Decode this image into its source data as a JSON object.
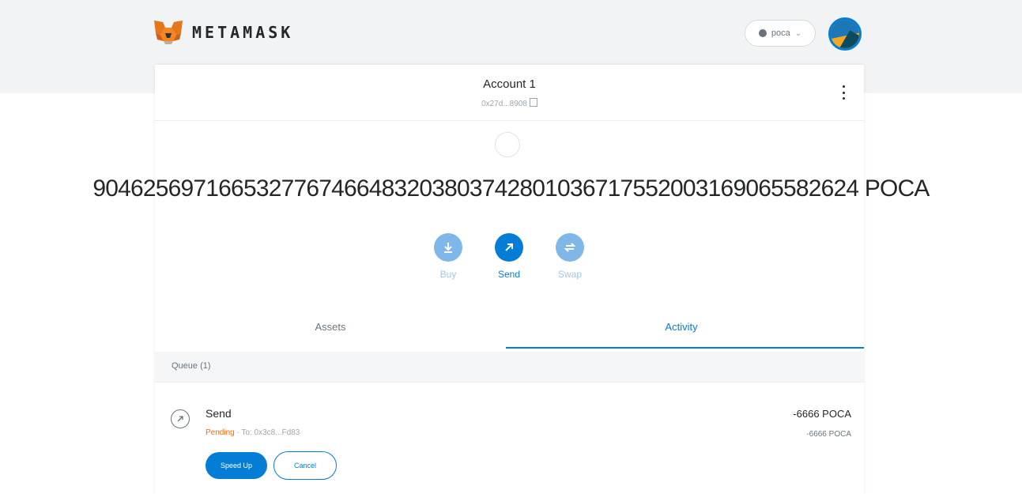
{
  "header": {
    "brand": "METAMASK",
    "network_label": "poca",
    "colors": {
      "background": "#f2f3f4",
      "accent": "#037dd6"
    }
  },
  "account": {
    "name": "Account 1",
    "address": "0x27d...8908"
  },
  "balance": {
    "amount": "9046256971665327767466483203803742801036717552003169065582624 POCA"
  },
  "actions": [
    {
      "label": "Buy",
      "icon": "download-icon",
      "color": "#7fb8e8"
    },
    {
      "label": "Send",
      "icon": "arrow-up-right-icon",
      "color": "#037dd6"
    },
    {
      "label": "Swap",
      "icon": "swap-icon",
      "color": "#7fb8e8"
    }
  ],
  "tabs": {
    "assets": "Assets",
    "activity": "Activity",
    "selected": "Activity"
  },
  "queue": {
    "label": "Queue (1)"
  },
  "transaction": {
    "title": "Send",
    "status": "Pending",
    "separator": " · ",
    "to": "To: 0x3c8...Fd83",
    "amount_primary": "-6666 POCA",
    "amount_secondary": "-6666 POCA",
    "speed_up_label": "Speed Up",
    "cancel_label": "Cancel",
    "status_color": "#f66a0a"
  }
}
